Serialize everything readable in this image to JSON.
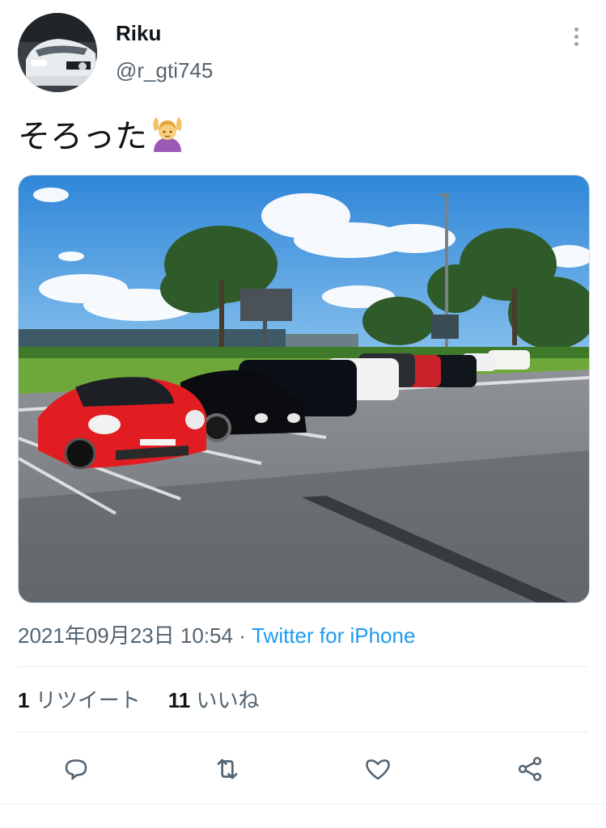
{
  "tweet": {
    "author": {
      "display_name": "Riku",
      "handle": "@r_gti745",
      "avatar_icon": "car-avatar"
    },
    "text": "そろった",
    "emoji_icon": "person-gesturing-ok-emoji",
    "timestamp": "2021年09月23日 10:54",
    "separator": "·",
    "source": "Twitter for iPhone",
    "stats": {
      "retweets_count": "1",
      "retweets_label": "リツイート",
      "likes_count": "11",
      "likes_label": "いいね"
    }
  },
  "actions": {
    "reply_icon": "reply-icon",
    "retweet_icon": "retweet-icon",
    "like_icon": "heart-icon",
    "share_icon": "share-icon"
  },
  "colors": {
    "link": "#1d9bf0",
    "secondary_text": "#536471",
    "primary_text": "#0f1419"
  }
}
